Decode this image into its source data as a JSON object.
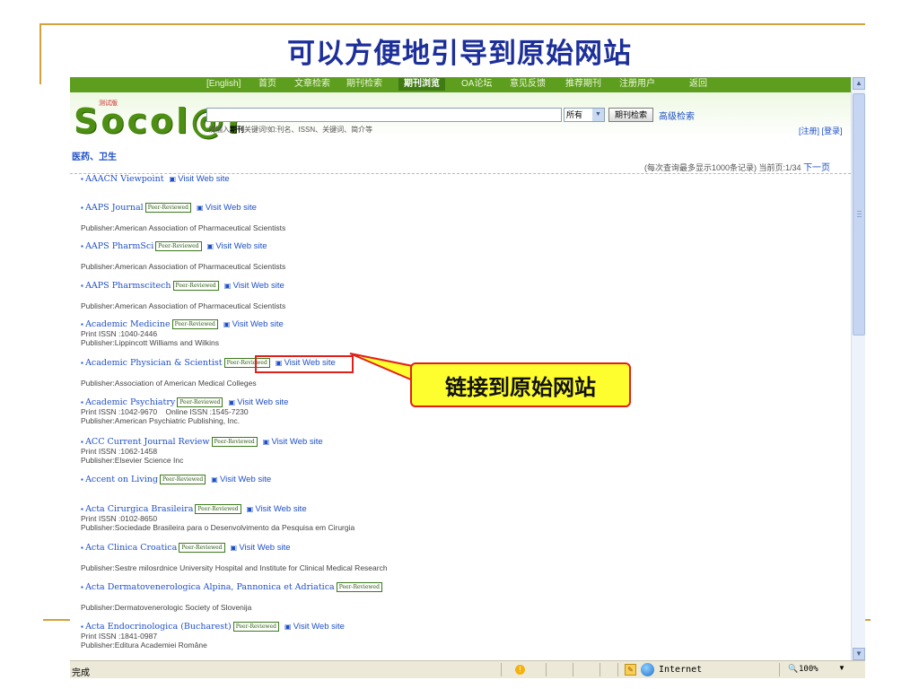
{
  "slide": {
    "title": "可以方便地引导到原始网站"
  },
  "nav": {
    "items": [
      "[English]",
      "首页",
      "文章检索",
      "期刊检索",
      "期刊浏览",
      "OA论坛",
      "意见反馈",
      "推荐期刊",
      "注册用户",
      "返回"
    ],
    "active_index": 4
  },
  "header": {
    "logo": "Socol@r",
    "logo_badge": "测试版",
    "search_hint_prefix": "请输入",
    "search_hint_bold": "期刊",
    "search_hint_suffix": "关键词!如:刊名、ISSN、关键词、简介等",
    "scope_value": "所有",
    "search_button": "期刊检索",
    "advanced_link": "高级检索",
    "register_link": "[注册]",
    "login_link": "[登录]"
  },
  "listing": {
    "category": "医药、卫生",
    "paging_text": "(每次查询最多显示1000条记录) 当前页:1/34",
    "next_page": "下一页",
    "peer_badge": "Peer-Reviewed",
    "visit_label": "Visit Web site",
    "entries": [
      {
        "name": "AAACN Viewpoint",
        "peer": false,
        "meta": []
      },
      {
        "name": "AAPS Journal",
        "peer": true,
        "meta": [
          "Publisher:American Association of Pharmaceutical Scientists"
        ]
      },
      {
        "name": "AAPS PharmSci",
        "peer": true,
        "meta": [
          "Publisher:American Association of Pharmaceutical Scientists"
        ]
      },
      {
        "name": "AAPS Pharmscitech",
        "peer": true,
        "meta": [
          "Publisher:American Association of Pharmaceutical Scientists"
        ]
      },
      {
        "name": "Academic Medicine",
        "peer": true,
        "meta": [
          "Print ISSN :1040-2446",
          "Publisher:Lippincott Williams and Wilkins"
        ]
      },
      {
        "name": "Academic Physician & Scientist",
        "peer": true,
        "meta": [
          "Publisher:Association of American Medical Colleges"
        ]
      },
      {
        "name": "Academic Psychiatry",
        "peer": true,
        "meta": [
          "Print ISSN :1042-9670    Online ISSN :1545-7230",
          "Publisher:American Psychiatric Publishing, Inc."
        ]
      },
      {
        "name": "ACC Current Journal Review",
        "peer": true,
        "meta": [
          "Print ISSN :1062-1458",
          "Publisher:Elsevier Science Inc"
        ]
      },
      {
        "name": "Accent on Living",
        "peer": true,
        "meta": []
      },
      {
        "name": "Acta Cirurgica Brasileira",
        "peer": true,
        "meta": [
          "Print ISSN :0102-8650",
          "Publisher:Sociedade Brasileira para o Desenvolvimento da Pesquisa em Cirurgia"
        ]
      },
      {
        "name": "Acta Clinica Croatica",
        "peer": true,
        "meta": [
          "Publisher:Sestre milosrdnice University Hospital and Institute for Clinical Medical Research"
        ]
      },
      {
        "name": "Acta Dermatovenerologica Alpina, Pannonica et Adriatica",
        "peer": true,
        "no_visit": true,
        "meta": [
          "Publisher:Dermatovenerologic Society of Slovenija"
        ]
      },
      {
        "name": "Acta Endocrinologica (Bucharest)",
        "peer": true,
        "meta": [
          "Print ISSN :1841-0987",
          "Publisher:Editura Academiei Române"
        ]
      }
    ]
  },
  "callout": {
    "text": "链接到原始网站",
    "border_color": "#e0201b",
    "fill_color": "#fefd2e"
  },
  "status": {
    "text": "完成",
    "zone": "Internet",
    "zoom": "100%"
  }
}
